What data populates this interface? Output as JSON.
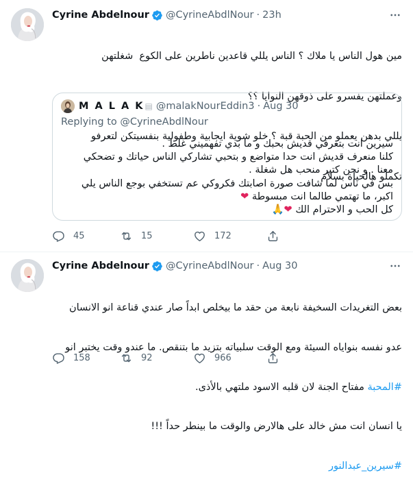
{
  "colors": {
    "accent": "#1d9bf0",
    "secondary_text": "#536471",
    "heart": "#e0245e",
    "border": "#cfd9de"
  },
  "tweets": [
    {
      "author_name": "Cyrine Abdelnour",
      "verified_icon": "verified-badge-icon",
      "handle": "@CyrineAbdlNour",
      "dot": "·",
      "time": "23h",
      "lines": [
        "مين هول الناس يا ملاك ؟ الناس يللي قاعدين ناطرين على الكوع  شغلتهن",
        "وعملتهن يفسرو على ذوقهن النوايا ؟؟",
        "يللي بدهن يعملو من الحبة قبة ؟ خلو شوية ايجابية وطفولية بنفسيتكن لتعرفو",
        "تكملو هالحياة بسلام"
      ],
      "quote": {
        "author_name": "M A L A K",
        "emoji_icon": "newspaper-emoji-icon",
        "handle": "@malakNourEddin3",
        "dot": "·",
        "time": "Aug 30",
        "replying_to": "Replying to @CyrineAbdlNour",
        "lines": [
          "سيرين انت بتعرفي قديش بحبك و ما بدي تفهميني غلط .",
          "كلنا منعرف  قديش انت حدا متواضع و بتحبي تشاركي الناس حياتك و تضحكي",
          "معنا . و نحن كتير منحب هل شغلة .",
          "بس في ناس لما شافت صورة اصابتك فكروكي عم تستخفي بوجع الناس يلي",
          "اكبر، ما تهتمي طالما انت مبسوطة",
          "كل الحب و الاحترام الك"
        ],
        "heart_symbol": "❤",
        "pray_symbol": "🙏"
      },
      "actions": {
        "reply_count": "45",
        "retweet_count": "15",
        "like_count": "172"
      }
    },
    {
      "author_name": "Cyrine Abdelnour",
      "verified_icon": "verified-badge-icon",
      "handle": "@CyrineAbdlNour",
      "dot": "·",
      "time": "Aug 30",
      "lines": [
        "بعض التغريدات السخيفة نابعة من حقد ما بيخلص ابداً صار عندي قناعة انو الانسان",
        "عدو نفسه بنواياه السيئة ومع الوقت سلبياته بتزيد ما بتنقص. ما عندو وقت يختبر انو",
        "مفتاح الجنة لان قلبه الاسود ملتهي بالأذى.",
        "يا انسان انت مش خالد على هالارض والوقت ما بينطر حداً !!!"
      ],
      "hashtag_love": "#المحبة",
      "hashtag_name": "#سيرين_عبدالنور",
      "actions": {
        "reply_count": "158",
        "retweet_count": "92",
        "like_count": "966"
      }
    }
  ]
}
